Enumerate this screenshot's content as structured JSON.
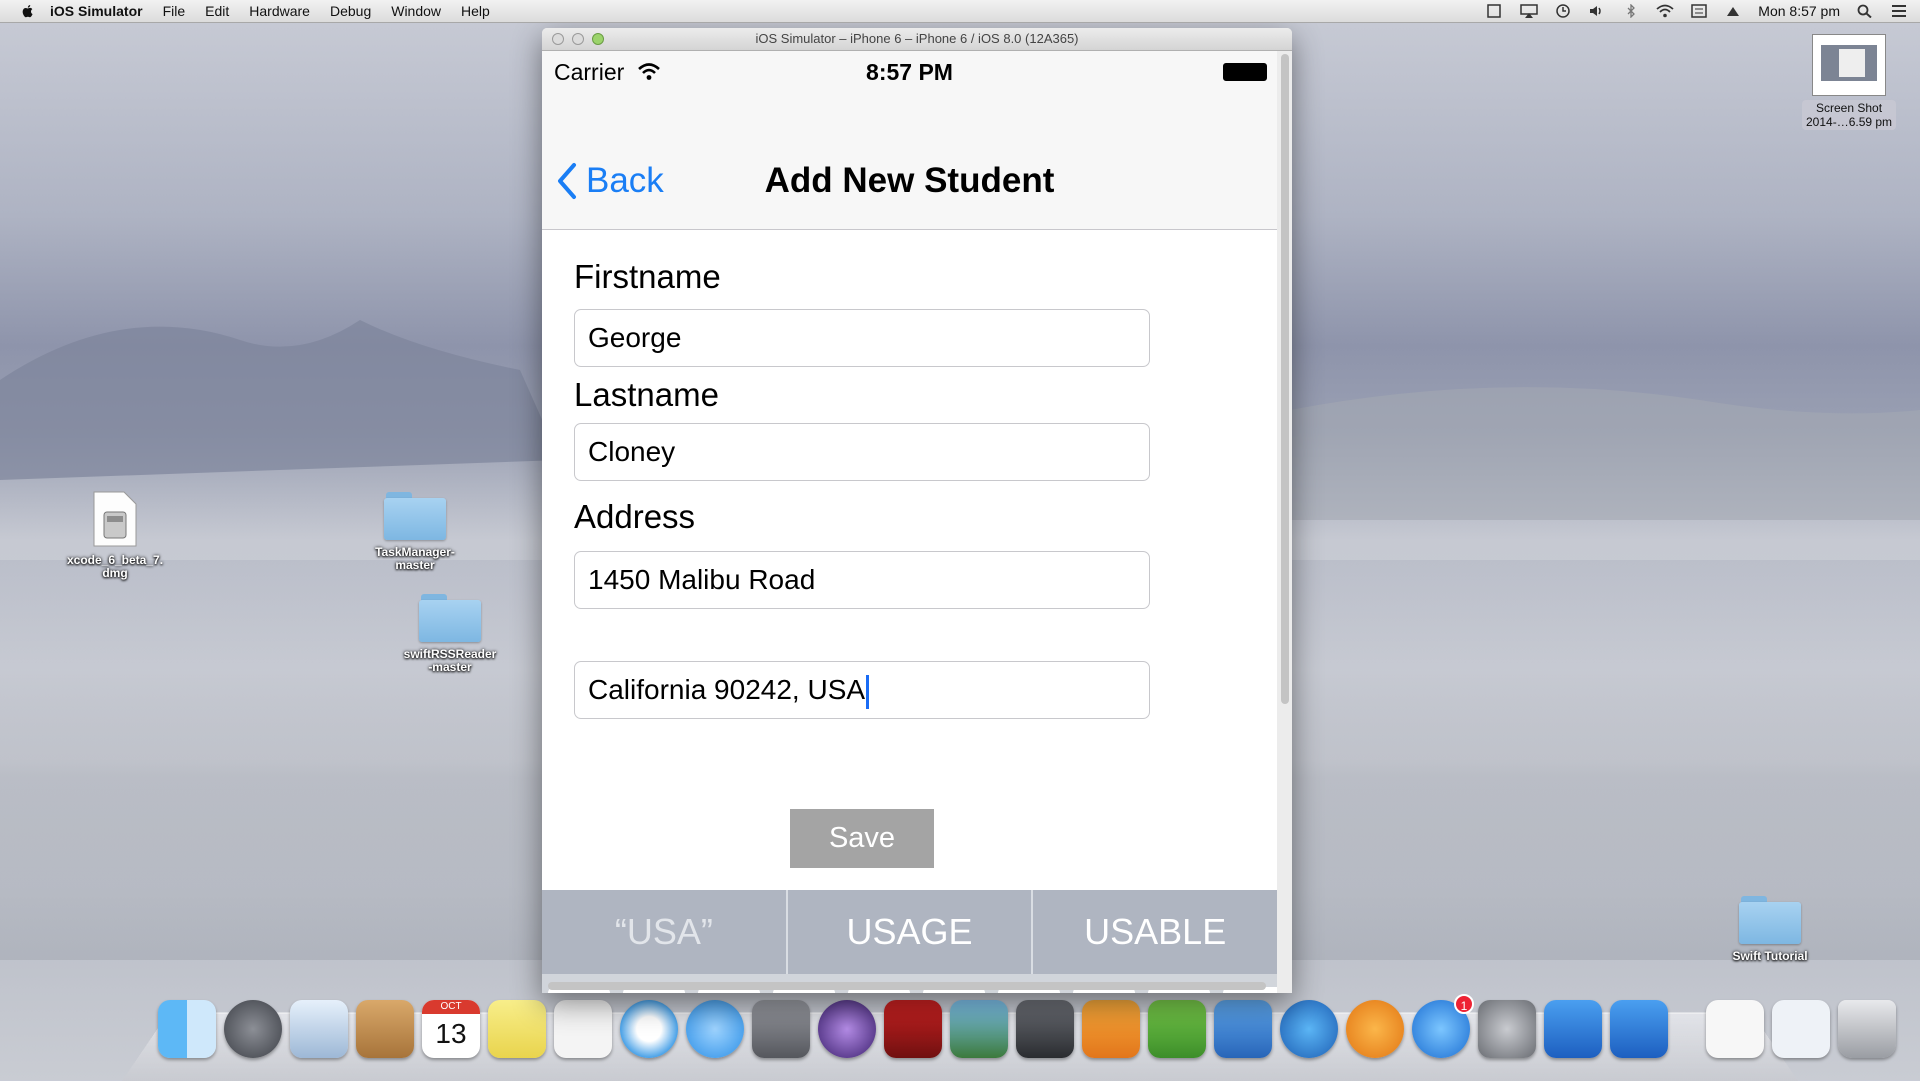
{
  "menubar": {
    "app": "iOS Simulator",
    "items": [
      "File",
      "Edit",
      "Hardware",
      "Debug",
      "Window",
      "Help"
    ],
    "clock": "Mon 8:57 pm"
  },
  "desktop": {
    "icons": [
      {
        "label": "xcode_6_beta_7.\ndmg"
      },
      {
        "label": "TaskManager-\nmaster"
      },
      {
        "label": "swiftRSSReader\n-master"
      },
      {
        "label": "Swift Tutorial"
      }
    ],
    "screenshot": {
      "line1": "Screen Shot",
      "line2": "2014-…6.59 pm"
    }
  },
  "simulator": {
    "window_title": "iOS Simulator – iPhone 6 – iPhone 6 / iOS 8.0 (12A365)",
    "status": {
      "carrier": "Carrier",
      "time": "8:57 PM"
    },
    "nav": {
      "back": "Back",
      "title": "Add New Student"
    },
    "form": {
      "firstname_label": "Firstname",
      "firstname_value": "George",
      "lastname_label": "Lastname",
      "lastname_value": "Cloney",
      "address_label": "Address",
      "address_line1": "1450 Malibu Road",
      "address_line2": "California 90242, USA",
      "save": "Save"
    },
    "suggestions": [
      "“USA”",
      "USAGE",
      "USABLE"
    ]
  },
  "dock": {
    "apps": [
      "finder",
      "launchpad",
      "mail",
      "contacts",
      "calendar",
      "notes",
      "reminders",
      "safari",
      "messages",
      "facetime",
      "eclipse",
      "photo-booth",
      "iphoto",
      "aperture",
      "pages",
      "numbers",
      "keynote",
      "itunes",
      "ibooks",
      "app-store",
      "system-preferences",
      "xcode",
      "simulator",
      "documents",
      "downloads",
      "trash"
    ],
    "calendar": {
      "month": "OCT",
      "day": "13"
    },
    "app_store_badge": "1"
  }
}
